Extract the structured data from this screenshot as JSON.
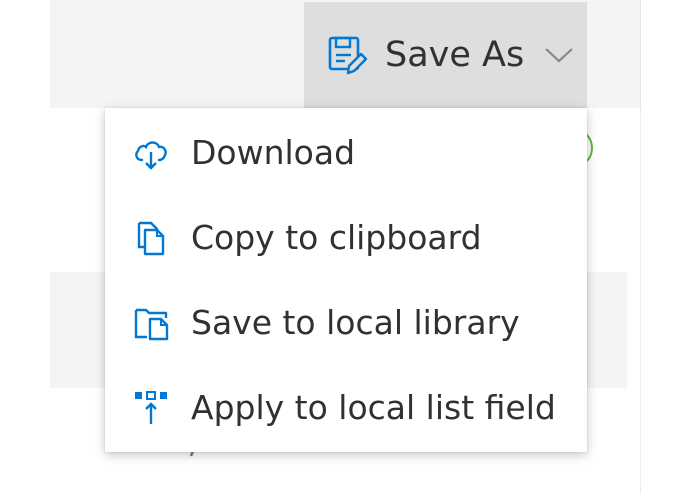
{
  "toolbar": {
    "save_as": {
      "label": "Save As",
      "icon": "save-edit-icon",
      "chevron": "chevron-down-icon"
    }
  },
  "menu": {
    "items": [
      {
        "label": "Download",
        "icon": "cloud-download-icon"
      },
      {
        "label": "Copy to clipboard",
        "icon": "copy-icon"
      },
      {
        "label": "Save to local library",
        "icon": "save-to-library-icon"
      },
      {
        "label": "Apply to local list field",
        "icon": "apply-to-field-icon"
      }
    ]
  },
  "colors": {
    "accent": "#0078d4",
    "text": "#323130",
    "button_bg": "#dedede",
    "toolbar_bg": "#f4f4f4",
    "status_green": "#69b23b"
  }
}
